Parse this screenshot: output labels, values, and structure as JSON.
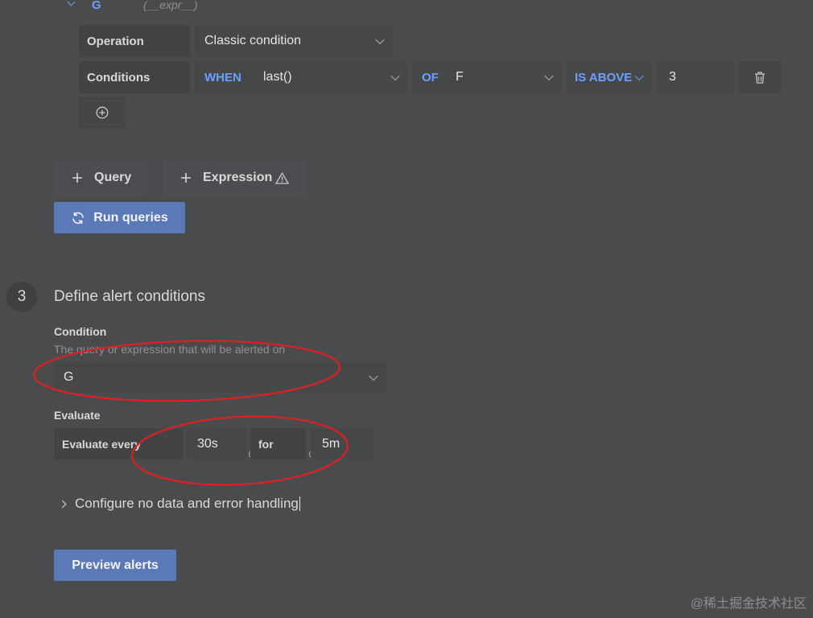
{
  "query_g": {
    "letter": "G",
    "type": "(__expr__)"
  },
  "operation": {
    "label": "Operation",
    "value": "Classic condition"
  },
  "conditions": {
    "label": "Conditions",
    "when": "WHEN",
    "func": "last()",
    "of": "OF",
    "query": "F",
    "comparator": "IS ABOVE",
    "threshold": "3"
  },
  "actions": {
    "add_query": "Query",
    "add_expression": "Expression",
    "run_queries": "Run queries"
  },
  "step3": {
    "number": "3",
    "title": "Define alert conditions",
    "condition_label": "Condition",
    "condition_desc": "The query or expression that will be alerted on",
    "condition_value": "G",
    "evaluate_label": "Evaluate",
    "evaluate_every_label": "Evaluate every",
    "evaluate_every_value": "30s",
    "for_label": "for",
    "for_value": "5m",
    "configure_label": "Configure no data and error handling",
    "preview_button": "Preview alerts"
  },
  "watermark": "@稀土掘金技术社区",
  "colors": {
    "accent": "#6e9fff",
    "primary_button": "#5b78b7",
    "annotation": "#e02020",
    "background": "#4a4b4d"
  }
}
